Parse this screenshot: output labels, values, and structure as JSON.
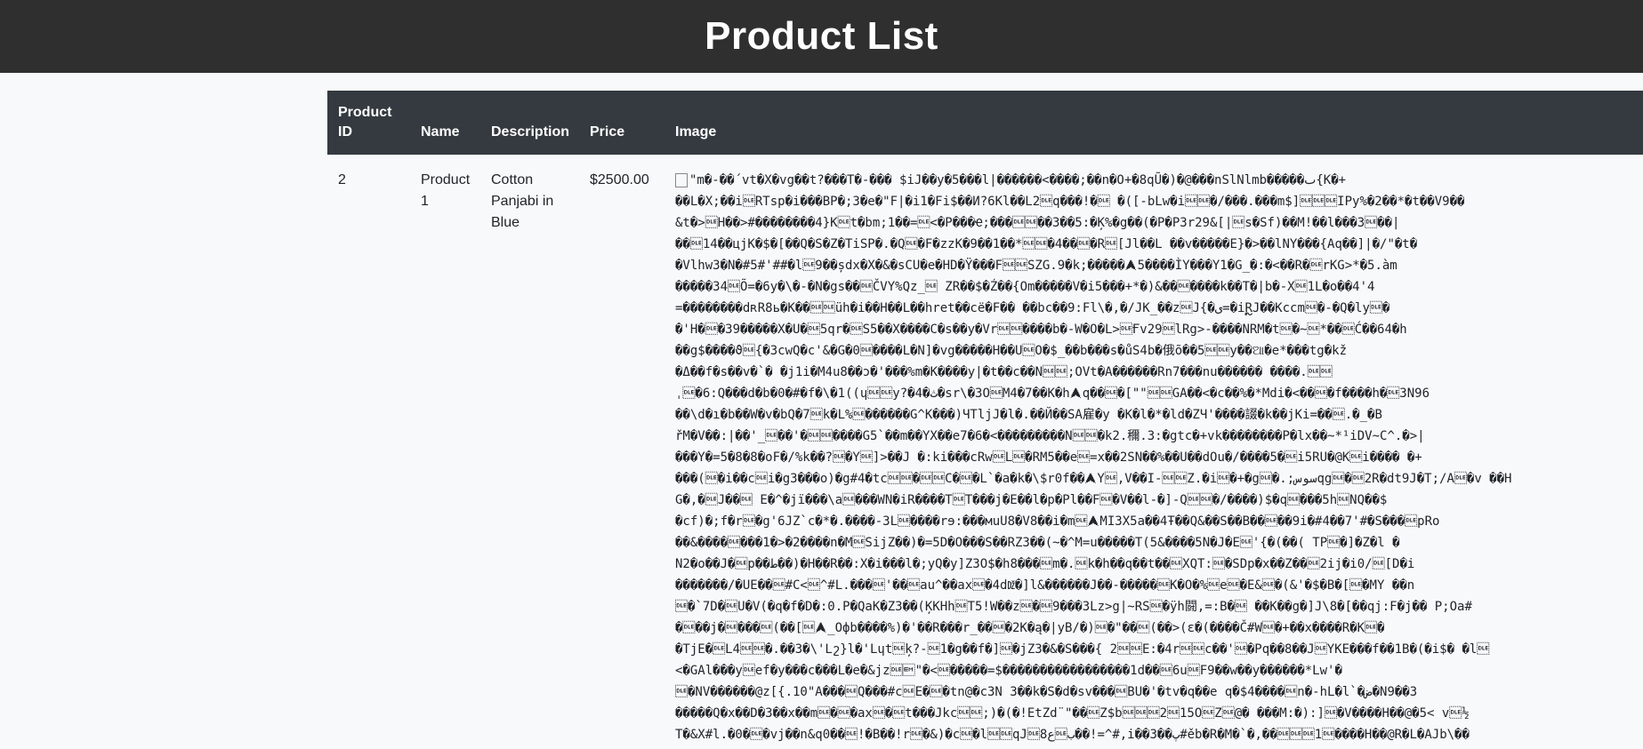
{
  "header": {
    "title": "Product List"
  },
  "table": {
    "columns": [
      "Product ID",
      "Name",
      "Description",
      "Price",
      "Image"
    ],
    "rows": [
      {
        "product_id": "2",
        "name": "Product 1",
        "description": "Cotton Panjabi in Blue",
        "price": "$2500.00",
        "image_text": "\"m�-��´vt�X�vg��t?���T�-��� $iJ��y�5���l|������<����;��n�O+�8qŨ�)�@���nSlNlmb�����ٮ{K�+\n��L�X;��i\u0010RTsp�i���BP�;3�e�\"F|�i1�Fi$��И?6Kl��L2\u0010q���!�\u0010 �([-bLw�i\u0010\u0010�/���.���m$]\u0010\u0010\u0010IPy%�2��*�t��V9��\n&t�>\u0010H��>#��������4}K\u0010t�bm;1��=\u0010<�P���Ҽ;���\u0010\u0010��3��5:�Ķ%�g��(�P�P3r29&[|\u0010s�Sf)��M!��l���3\u0010��|\n��\u001014��цjK�$�[��Q�S�Z�TiSP�.�Q\u0010�F�zzK�9��1��*\u0010\u0010�4��\u0010�R\u0010[Jl��L ��v�����E}�>��lNY���{Aq��]|�/\"�t�\n�Vlhw3�N�#5#'##�l\u00109��șdx�X�&�sCU�e�HD�Ÿ���F\u0010\u0010SZG.9�k;�����⮝5����ÌY���Y1�G_�:�<��R�\u0010rKG>*�5.àm\n�����34\u0010Õ=�6y�\\�-�N�gs��\u0010ČVY%Qz_\u0010 ZR��$�Ź��{Om�����V�i5���+*�)&��\u0010����k��T�|b�-X\u00101L�o��4'4\n=��������dʀR8ь�K��\u0010\u0010üh�i��H��L��hret��сё�F�� ��bc��9:Fl\\�,�/JK_��z\u0010J{�ی=�iຼRJ��Kccm\u0010�-�Q�ly\u0010�\n�'H�\u0010�39�����X�U�\u00105qr�\u0010S5��X����C�s��y�Vr\u0010\u0010����b�-W�O�L>\u0010Ғv29\u0010lRg>-����NRM�t\u0010�~\u0010*��\u0010Ć��64�h\n��g$����ϑ\u0010{�3cwQ�c'&�G�0\u0010����L�N]�vg�����H��U\u0010O�$_��b���s�ůS4b�俄õ��5\u0010\u0010y��ଆ�e*���tg�kž\n�Δ��f�s��v�`� �j1i�M4u8��ɔ�'���%m�K����y|�t��c��N\u0010\u0010;OVt�A������Rn7���nu������ ����.\u0010\u0010\nˌ\u0010�6:Q���d�b�0�#�f�\\�1((ɥ\u0010\u0010y?�4�ث�sr\\�3O\u0010M4�7��K�h⮝q��\u0010�[\"\"\u0010\u0010GA��<�c��%�*Mdi�<��\u0010�f����h�\u00103N96\n��\\d�ı�b��W�v�bQ�7\u0010k�L%\u0010������G^K���)ЧTljJ�l�.��Й��SA雇�y �K�l�*�ld�ZЧ'����諁�k��jKi=��\u0010.�_�B\nřM�V��:|��'_\u0010��'�\u0010\u0010����G5`��m��YX��e7�6�<���������N\u0010\u0010�k2.穪.3:�gtc�+vk��������P�lx��~*¹iDV~C^.�>|\n���Y�=5�8�8�oF�/%k��?\u0010�Y\u0010]>��J �:ki���cRw\u0010L\u0010�RM5��e\u0010=x��2SN��%��U��dOu�/����5�\u0010i5RU�@K\u0010i���� �+\n���(\u0010�i��c\u0010i�g3���o)�g#4�tc\u0010\u0010�\u0010\u0010C�\u0010�L`�a�k�\\$r0f��⮝Y\u0010,V��I-\u0010\u0010Z.�i\u0010�+�g\u0010�.;سوسqg\u0010�\u00102R�dt9J�T;/A\u0010�v ��H\nG�,�\u0010J��\u0010 E�^�jї���\\a\u0010���WN�iR����T\u0010T���j�E��l�p�Pl��F\u0010�V��l-�]-Q\u0010\u0010�/����)$�q\u0010���5h\u0010NQ��$\n�cf)�;f�r\u0010�g'6JZ`c�*�.����-3L\u0010����rɘ:���мuU8�V8��i�m\u0010⮝MI3X5a��4Ŧ��Q&��S��B��\u0010��9i�#4��7'#�S���\u0010pRo\n��&����\u0010���1�>�2����n�M\u0010SijZ��)�=5D�O���S��RZ3��(~�^M=u�����T(5&����5N�J�E\u0010'{�(��( TP\u0010�]�Z�l �\nN2�o��J�\u0010p��ط��)�H��R��:X�i���l�;yQ�y]Z3O$�h8���\u0010m�.\u0010k�h��q��t��\u0010XQT:\u0010�SDp�x��Z��\u00102ij�i0/\u0010[D�i\n�������/�UE��\u0010#C<\u0010^#L.���\u0010'��\u0010au^��ax\u0010�4dǅ�]l&������J��-�����\u0010K�O�%\u0010e\u0010�E&\u0010�(&'�$�B�[\u0010�MY ��n\n\u0010�`7D�\u0010U�V(�q�f�D�:0.P�QaK�Z3��(ĶKHh\u0010T5!W��z\u0010�\u00109���3Lz>g|~RS\u0010�ÿh闘,=:B�\u0010 ��K��g�]J\\8�[��qj:F�j�� P;Oa#\n�\u0010��j�\u0010���\u0010(��[\u0010⮝_Oфb����%)�'��R���r_��\u0010�2K�ą�|yB/�)\u0010�\"��\u0010(��>(ε�(����Č#W\u0010�+��x����R�K\u0010�\n�TjE�\u0010L4\u0010\u0010�.��3�\\'Lշ}l�'Lɥt\u0010ķ?-\u00101�g��f�]\u0010�jZ3�&�S���{ 2\u0010\u0010E:�4r\u0010\u0010c��'\u0010�Pq��8��J\u0010YKE���f��1B�(�i$� �l\u0010\n<�GAl���y\u0010ef�y���c���L�e�&jz\u0010\u0019\"�<\u0010�����=$�����������������1d��\u00106u\u0010F9��w��y������*Lw'�\n\u0010�NV������@z[{.10\"A���\u0010Q���#c\u0010E�\u0010�tn@�c3N 3��k�S�d�sv���\u0010BU�'�tv�q��e q�$4����\u0010n�-hL�l`�ض�N9��3\n�����Q�x��D�3��x��m\u0010�\u0010�ax\u0010�\u0010t���Jkc\u0010\u0010;)�(�!EtZd¨\"��\u0010Z$b\u0010\u0010\u00102\u001015O\u0010Z\u0010@� ���M:�):]\u0010�V����H��@�5< v\u0010½\nT�&X#l.�0�\u0010�vj��n&q0��\u0010!�B��!r\u0010�&)�c\u0010�l\u0010\u0010qJب\u0010ع\u00108��!=^#,i��3��پ#ěb�R�M�`�,��\u0010\u0010\u00101\u0010����H��@R�L�AJb\\��"
      }
    ]
  }
}
